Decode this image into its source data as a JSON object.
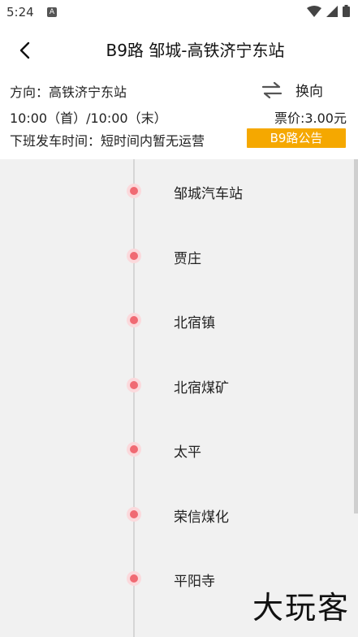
{
  "status_bar": {
    "time": "5:24",
    "notif": "A"
  },
  "header": {
    "title": "B9路 邹城-高铁济宁东站"
  },
  "info": {
    "direction": "方向：高铁济宁东站",
    "swap_label": "换向",
    "times": "10:00（首）/10:00（末）",
    "fare": "票价:3.00元",
    "last_bus": "下班发车时间：短时间内暂无运营",
    "notice_button": "B9路公告"
  },
  "stops": [
    {
      "name": "邹城汽车站"
    },
    {
      "name": "贾庄"
    },
    {
      "name": "北宿镇"
    },
    {
      "name": "北宿煤矿"
    },
    {
      "name": "太平"
    },
    {
      "name": "荣信煤化"
    },
    {
      "name": "平阳寺"
    }
  ],
  "watermark": "大玩客",
  "colors": {
    "accent": "#f5a800",
    "stop_dot": "#f06a73",
    "list_bg": "#f1f1f1"
  }
}
